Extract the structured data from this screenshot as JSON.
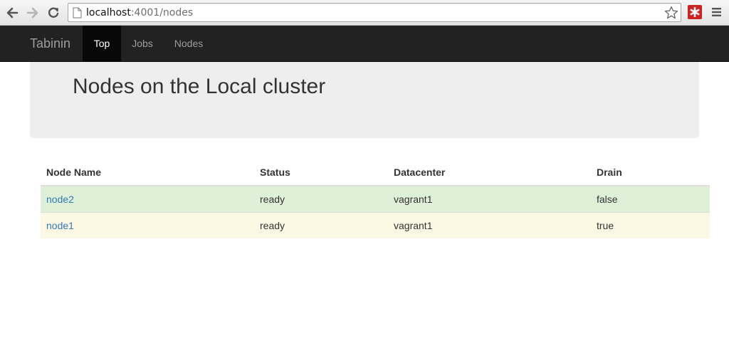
{
  "browser": {
    "url_host": "localhost",
    "url_rest": ":4001/nodes"
  },
  "navbar": {
    "brand": "Tabinin",
    "items": [
      {
        "label": "Top",
        "active": true
      },
      {
        "label": "Jobs",
        "active": false
      },
      {
        "label": "Nodes",
        "active": false
      }
    ]
  },
  "page": {
    "title": "Nodes on the Local cluster"
  },
  "table": {
    "headers": [
      "Node Name",
      "Status",
      "Datacenter",
      "Drain"
    ],
    "rows": [
      {
        "name": "node2",
        "status": "ready",
        "datacenter": "vagrant1",
        "drain": "false",
        "variant": "success"
      },
      {
        "name": "node1",
        "status": "ready",
        "datacenter": "vagrant1",
        "drain": "true",
        "variant": "warning"
      }
    ]
  },
  "colors": {
    "navbar_bg": "#222222",
    "navbar_active_bg": "#080808",
    "jumbotron_bg": "#eeeeee",
    "link": "#337ab7",
    "row_success": "#dff0d8",
    "row_warning": "#fcf8e3",
    "extension_red": "#cc2222"
  },
  "icons": {
    "back": "back-arrow-icon",
    "forward": "forward-arrow-icon",
    "reload": "reload-icon",
    "page": "page-icon",
    "bookmark": "star-icon",
    "extension": "extension-icon",
    "menu": "hamburger-menu-icon"
  }
}
